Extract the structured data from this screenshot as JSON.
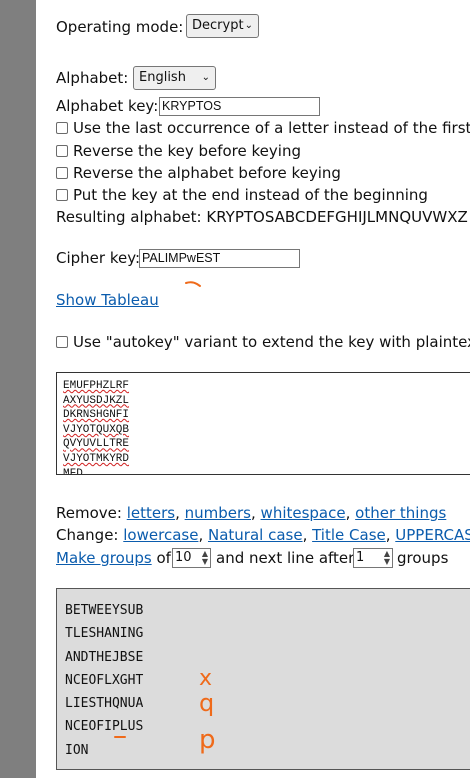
{
  "mode": {
    "label": "Operating mode:",
    "value": "Decrypt"
  },
  "alphabet": {
    "label": "Alphabet:",
    "value": "English",
    "key_label": "Alphabet key:",
    "key_value": "KRYPTOS",
    "options": [
      "Use the last occurrence of a letter instead of the first",
      "Reverse the key before keying",
      "Reverse the alphabet before keying",
      "Put the key at the end instead of the beginning"
    ],
    "resulting_label": "Resulting alphabet:",
    "resulting_value": "KRYPTOSABCDEFGHIJLMNQUVWXZ"
  },
  "cipher": {
    "label": "Cipher key:",
    "value": "PALIMPwEST"
  },
  "tableau_link": "Show Tableau",
  "autokey_label": "Use \"autokey\" variant to extend the key with plaintext",
  "input_lines": [
    "EMUFPHZLRF",
    "AXYUSDJKZL",
    "DKRNSHGNFI",
    "VJYOTQUXQB",
    "QVYUVLLTRE",
    "VJYOTMKYRD",
    "MFD"
  ],
  "remove": {
    "label": "Remove:",
    "links": [
      "letters",
      "numbers",
      "whitespace",
      "other things"
    ]
  },
  "change": {
    "label": "Change:",
    "links": [
      "lowercase",
      "Natural case",
      "Title Case",
      "UPPERCASE"
    ]
  },
  "groups": {
    "link": "Make groups",
    "of": "of",
    "size": "10",
    "middle": "and next line after",
    "count": "1",
    "end": "groups"
  },
  "output_lines": [
    "BETWEEYSUB",
    "TLESHANING",
    "ANDTHEJBSE",
    "NCEOFLXGHT",
    "LIESTHQNUA",
    "NCEOFIPLUS",
    "ION"
  ],
  "annotations": {
    "color": "#ef6a1a",
    "handwritten": [
      "x",
      "q",
      "p"
    ]
  }
}
